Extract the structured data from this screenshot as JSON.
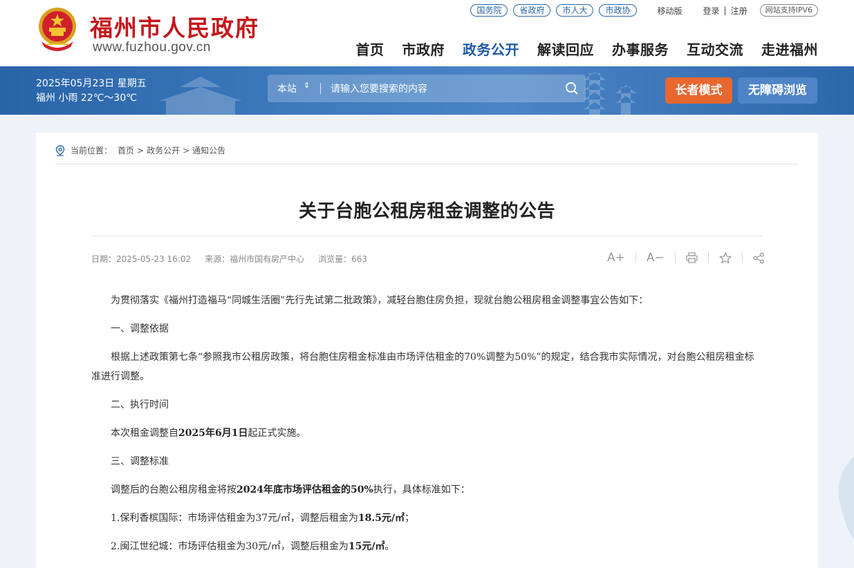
{
  "header": {
    "site_name": "福州市人民政府",
    "site_url": "www.fuzhou.gov.cn",
    "top_pills": [
      "国务院",
      "省政府",
      "市人大",
      "市政协"
    ],
    "mobile_label": "移动版",
    "login_label": "登录",
    "login_sep": "|",
    "register_label": "注册",
    "ipv6_label": "网站支持IPV6",
    "nav": [
      "首页",
      "市政府",
      "政务公开",
      "解读回应",
      "办事服务",
      "互动交流",
      "走进福州"
    ],
    "active_nav": "政务公开"
  },
  "banner": {
    "date_line": "2025年05月23日 星期五",
    "weather_line": "福州 小雨 22℃～30℃",
    "search_scope": "本站",
    "search_placeholder": "请输入您要搜索的内容",
    "elder_mode_label": "长者模式",
    "accessible_label": "无障碍浏览"
  },
  "breadcrumb": {
    "prefix": "当前位置：",
    "items": [
      "首页",
      "政务公开",
      "通知公告"
    ],
    "separator": ">"
  },
  "article": {
    "title": "关于台胞公租房租金调整的公告",
    "date": "日期：2025-05-23 16:02",
    "source": "来源：福州市国有房产中心",
    "views": "浏览量：663",
    "tools": {
      "font_larger": "A+",
      "font_smaller": "A−"
    },
    "p1": "为贯彻落实《福州打造福马“同城生活圈”先行先试第二批政策》，减轻台胞住房负担，现就台胞公租房租金调整事宜公告如下：",
    "h1": "一、调整依据",
    "p2": "根据上述政策第七条“参照我市公租房政策，将台胞住房租金标准由市场评估租金的70%调整为50%”的规定，结合我市实际情况，对台胞公租房租金标准进行调整。",
    "h2": "二、执行时间",
    "p3_pre": "本次租金调整自",
    "p3_bold": "2025年6月1日",
    "p3_post": "起正式实施。",
    "h3": "三、调整标准",
    "p4_pre": "调整后的台胞公租房租金将按",
    "p4_bold": "2024年底市场评估租金的50%",
    "p4_post": "执行，具体标准如下：",
    "item1_pre": "1.保利香槟国际：市场评估租金为37元/㎡，调整后租金为",
    "item1_bold": "18.5元/㎡",
    "item1_post": "；",
    "item2_pre": "2.闽江世纪城：市场评估租金为30元/㎡，调整后租金为",
    "item2_bold": "15元/㎡",
    "item2_post": "。"
  },
  "colors": {
    "brand_red": "#c4161c",
    "banner_blue": "#2a64a8",
    "active_nav": "#1f5aa6",
    "elder_orange": "#e8672f",
    "accessible_blue": "#4e85c6"
  }
}
